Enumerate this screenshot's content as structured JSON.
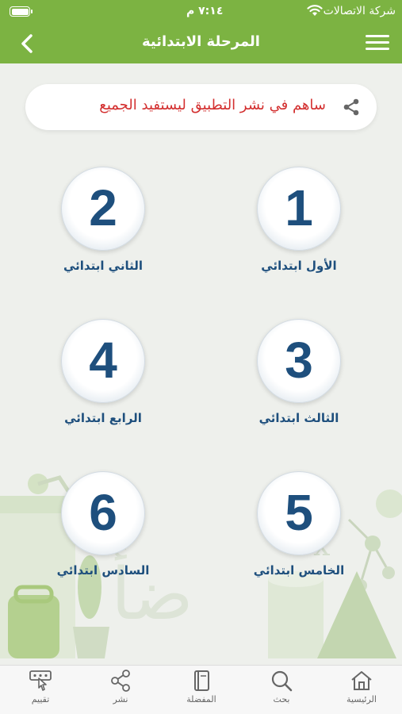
{
  "status_bar": {
    "carrier": "شركة الاتصالات",
    "time": "٧:١٤ م"
  },
  "header": {
    "title": "المرحلة الابتدائية",
    "back_icon": "chevron-left-icon",
    "menu_icon": "hamburger-menu-icon"
  },
  "share_banner": {
    "text": "ساهم في نشر التطبيق ليستفيد الجميع",
    "icon": "share-icon"
  },
  "grades": [
    {
      "number": "1",
      "label": "الأول ابتدائي"
    },
    {
      "number": "2",
      "label": "الثاني ابتدائي"
    },
    {
      "number": "3",
      "label": "الثالث ابتدائي"
    },
    {
      "number": "4",
      "label": "الرابع ابتدائي"
    },
    {
      "number": "5",
      "label": "الخامس ابتدائي"
    },
    {
      "number": "6",
      "label": "السادس ابتدائي"
    }
  ],
  "bottom_nav": [
    {
      "label": "الرئيسية",
      "icon": "home-icon"
    },
    {
      "label": "بحث",
      "icon": "search-icon"
    },
    {
      "label": "المفضلة",
      "icon": "book-icon"
    },
    {
      "label": "نشر",
      "icon": "share-icon"
    },
    {
      "label": "تقييم",
      "icon": "rate-icon"
    }
  ],
  "colors": {
    "primary_green": "#7cb342",
    "number_blue": "#1e4f7d",
    "banner_text_red": "#d32f2f"
  }
}
